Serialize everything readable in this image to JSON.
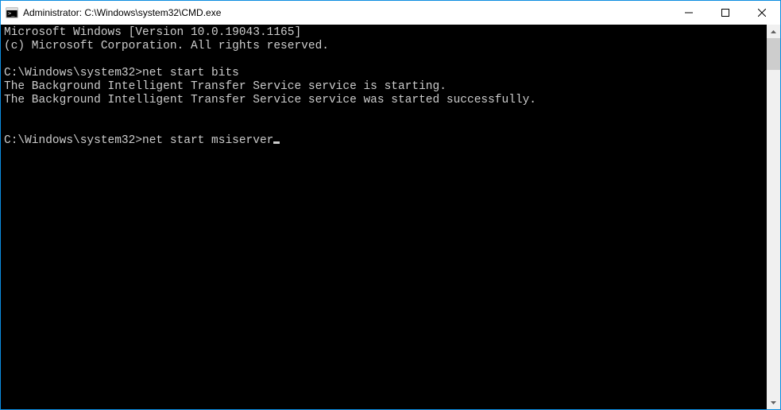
{
  "titlebar": {
    "title": "Administrator: C:\\Windows\\system32\\CMD.exe"
  },
  "terminal": {
    "line1": "Microsoft Windows [Version 10.0.19043.1165]",
    "line2": "(c) Microsoft Corporation. All rights reserved.",
    "blank1": "",
    "prompt1_path": "C:\\Windows\\system32>",
    "prompt1_cmd": "net start bits",
    "output1": "The Background Intelligent Transfer Service service is starting.",
    "output2": "The Background Intelligent Transfer Service service was started successfully.",
    "blank2": "",
    "blank3": "",
    "prompt2_path": "C:\\Windows\\system32>",
    "prompt2_cmd": "net start msiserver"
  }
}
